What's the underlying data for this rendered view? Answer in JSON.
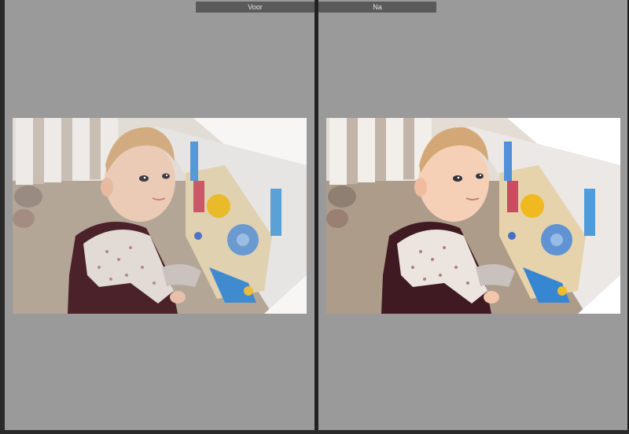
{
  "compare": {
    "before_label": "Voor",
    "after_label": "Na"
  },
  "colors": {
    "panel_bg": "#9a9a9a",
    "tab_bg": "#5a5a5a",
    "divider": "#222222"
  },
  "photo": {
    "subject": "baby-in-playpen-photo"
  }
}
